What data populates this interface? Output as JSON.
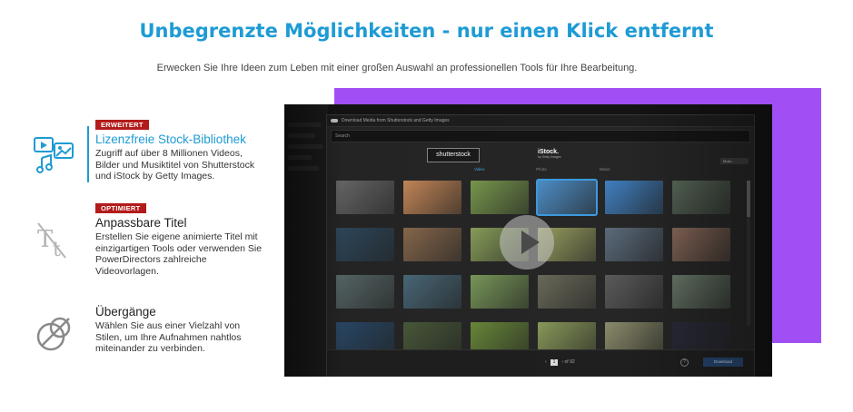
{
  "header": {
    "title": "Unbegrenzte Möglichkeiten - nur einen Klick entfernt",
    "subtitle": "Erwecken Sie Ihre Ideen zum Leben mit einer großen Auswahl an professionellen Tools für Ihre Bearbeitung."
  },
  "features": [
    {
      "badge": "ERWEITERT",
      "title": "Lizenzfreie Stock-Bibliothek",
      "description": "Zugriff auf über 8 Millionen Videos, Bilder und Musiktitel von Shutterstock und iStock by Getty Images.",
      "icon": "stock-media-icon",
      "active": true
    },
    {
      "badge": "OPTIMIERT",
      "title": "Anpassbare Titel",
      "description": "Erstellen Sie eigene animierte Titel mit einzigartigen Tools oder verwenden Sie PowerDirectors zahlreiche Videovorlagen.",
      "icon": "title-text-icon",
      "active": false
    },
    {
      "badge": "",
      "title": "Übergänge",
      "description": "Wählen Sie aus einer Vielzahl von Stilen, um Ihre Aufnahmen nahtlos miteinander zu verbinden.",
      "icon": "transition-icon",
      "active": false
    }
  ],
  "video": {
    "window_title": "Download Media from Shutterstock and Getty Images",
    "search_placeholder": "Search",
    "logo_shutterstock": "shutterstock",
    "logo_istock": "iStock.",
    "logo_istock_sub": "by Getty Images",
    "filter_label": "Most...",
    "tabs": [
      "Video",
      "Photo",
      "Music"
    ],
    "page_current": "1",
    "page_total": "of 92",
    "download_label": "Download",
    "help_label": "?",
    "play_icon": "play-icon",
    "thumbnail_colors": [
      "#6b6b6b",
      "#c98a5a",
      "#7a9a4e",
      "#4d8fc7",
      "#3f7fbf",
      "#5a6a5a",
      "#2f4a5f",
      "#8a6a4e",
      "#8aa05a",
      "#9aa060",
      "#5a6a7a",
      "#8a6a5a",
      "#5a6a6a",
      "#4a6a7a",
      "#7a9a5a",
      "#6a6a5a",
      "#5a5a5a",
      "#6a7a6a",
      "#2a4a6a",
      "#4a5a3a",
      "#6a8a3a",
      "#8a9a5a",
      "#8a8a6a",
      "#2a2a3a"
    ]
  }
}
